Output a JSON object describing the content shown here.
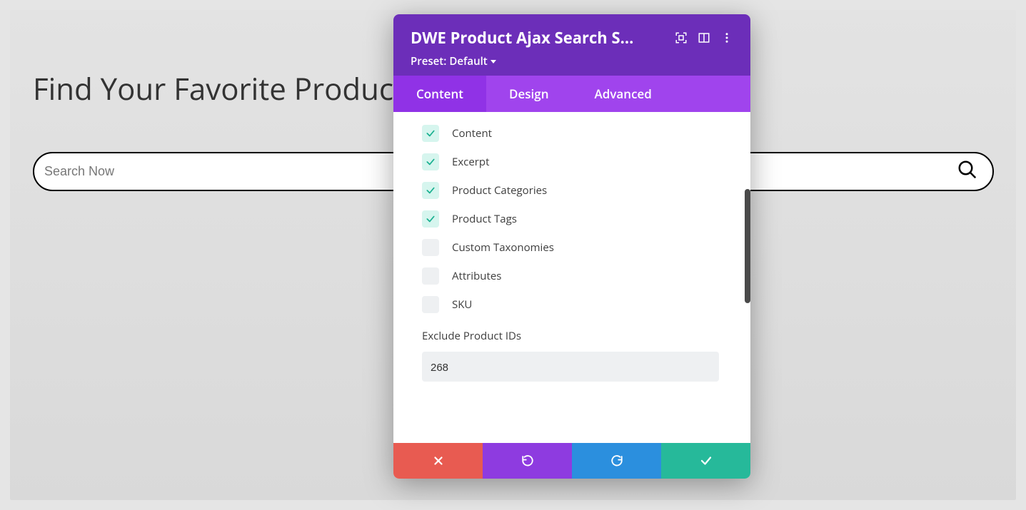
{
  "page": {
    "title": "Find Your Favorite Products",
    "search_placeholder": "Search Now"
  },
  "modal": {
    "title": "DWE Product Ajax Search S...",
    "preset_prefix": "Preset:",
    "preset_name": "Default",
    "tabs": {
      "content": "Content",
      "design": "Design",
      "advanced": "Advanced",
      "active": "content"
    },
    "search_in_options": [
      {
        "label": "Content",
        "checked": true
      },
      {
        "label": "Excerpt",
        "checked": true
      },
      {
        "label": "Product Categories",
        "checked": true
      },
      {
        "label": "Product Tags",
        "checked": true
      },
      {
        "label": "Custom Taxonomies",
        "checked": false
      },
      {
        "label": "Attributes",
        "checked": false
      },
      {
        "label": "SKU",
        "checked": false
      }
    ],
    "exclude_label": "Exclude Product IDs",
    "exclude_value": "268",
    "footer_buttons": {
      "cancel": "cancel",
      "undo": "undo",
      "redo": "redo",
      "save": "save"
    },
    "header_icons": {
      "expand": "expand",
      "columns": "columns",
      "more": "more"
    }
  }
}
